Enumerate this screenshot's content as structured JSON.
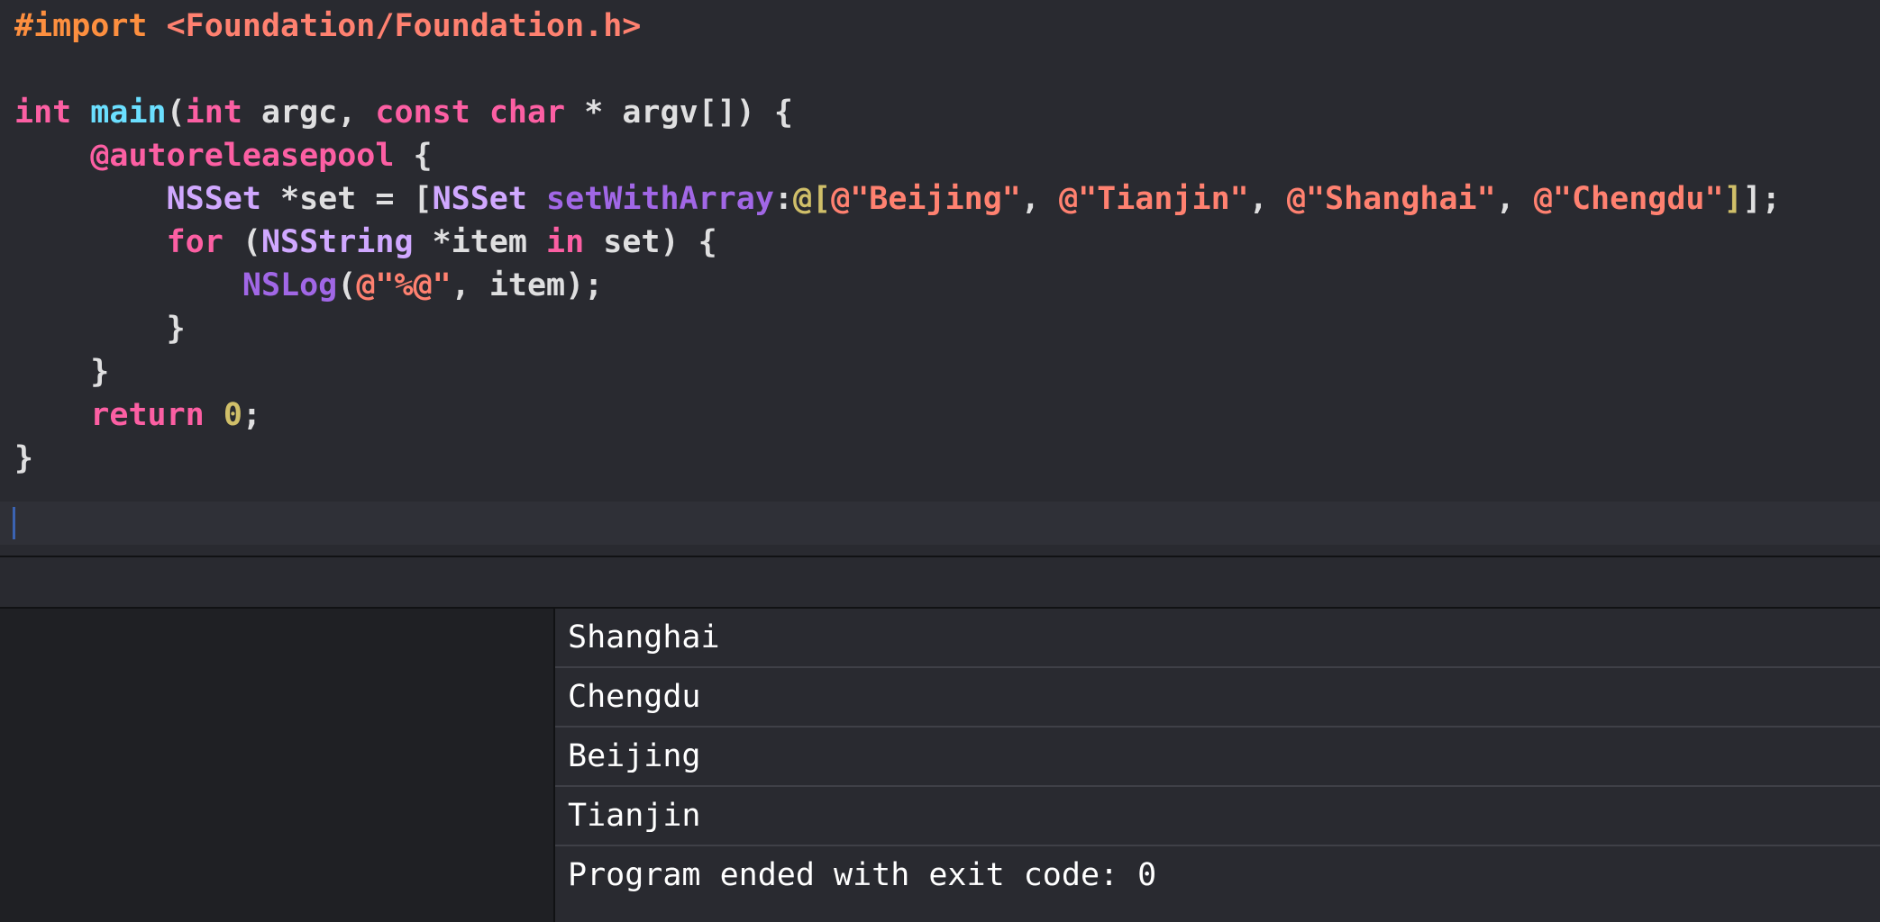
{
  "editor": {
    "lines": [
      {
        "tokens": [
          {
            "t": "#import ",
            "c": "pp"
          },
          {
            "t": "<Foundation/Foundation.h>",
            "c": "strp"
          }
        ]
      },
      {
        "tokens": []
      },
      {
        "tokens": [
          {
            "t": "int",
            "c": "kw"
          },
          {
            "t": " ",
            "c": "plain"
          },
          {
            "t": "main",
            "c": "fnd"
          },
          {
            "t": "(",
            "c": "plain"
          },
          {
            "t": "int",
            "c": "kw"
          },
          {
            "t": " argc, ",
            "c": "plain"
          },
          {
            "t": "const",
            "c": "kw"
          },
          {
            "t": " ",
            "c": "plain"
          },
          {
            "t": "char",
            "c": "kw"
          },
          {
            "t": " * argv[]) {",
            "c": "plain"
          }
        ]
      },
      {
        "tokens": [
          {
            "t": "    ",
            "c": "plain"
          },
          {
            "t": "@autoreleasepool",
            "c": "kw"
          },
          {
            "t": " {",
            "c": "plain"
          }
        ]
      },
      {
        "tokens": [
          {
            "t": "        ",
            "c": "plain"
          },
          {
            "t": "NSSet",
            "c": "cls"
          },
          {
            "t": " *set = [",
            "c": "plain"
          },
          {
            "t": "NSSet",
            "c": "cls"
          },
          {
            "t": " ",
            "c": "plain"
          },
          {
            "t": "setWithArray",
            "c": "meth"
          },
          {
            "t": ":",
            "c": "plain"
          },
          {
            "t": "@[",
            "c": "lit"
          },
          {
            "t": "@\"Beijing\"",
            "c": "strp"
          },
          {
            "t": ", ",
            "c": "plain"
          },
          {
            "t": "@\"Tianjin\"",
            "c": "strp"
          },
          {
            "t": ", ",
            "c": "plain"
          },
          {
            "t": "@\"Shanghai\"",
            "c": "strp"
          },
          {
            "t": ", ",
            "c": "plain"
          },
          {
            "t": "@\"Chengdu\"",
            "c": "strp"
          },
          {
            "t": "]",
            "c": "lit"
          },
          {
            "t": "];",
            "c": "plain"
          }
        ]
      },
      {
        "tokens": [
          {
            "t": "        ",
            "c": "plain"
          },
          {
            "t": "for",
            "c": "kw"
          },
          {
            "t": " (",
            "c": "plain"
          },
          {
            "t": "NSString",
            "c": "cls"
          },
          {
            "t": " *item ",
            "c": "plain"
          },
          {
            "t": "in",
            "c": "kw"
          },
          {
            "t": " set) {",
            "c": "plain"
          }
        ]
      },
      {
        "tokens": [
          {
            "t": "            ",
            "c": "plain"
          },
          {
            "t": "NSLog",
            "c": "meth"
          },
          {
            "t": "(",
            "c": "plain"
          },
          {
            "t": "@\"%@\"",
            "c": "strp"
          },
          {
            "t": ", item);",
            "c": "plain"
          }
        ]
      },
      {
        "tokens": [
          {
            "t": "        }",
            "c": "plain"
          }
        ]
      },
      {
        "tokens": [
          {
            "t": "    }",
            "c": "plain"
          }
        ]
      },
      {
        "tokens": [
          {
            "t": "    ",
            "c": "plain"
          },
          {
            "t": "return",
            "c": "kw"
          },
          {
            "t": " ",
            "c": "plain"
          },
          {
            "t": "0",
            "c": "num"
          },
          {
            "t": ";",
            "c": "plain"
          }
        ]
      },
      {
        "tokens": [
          {
            "t": "}",
            "c": "plain"
          }
        ]
      }
    ]
  },
  "console": {
    "lines": [
      "Shanghai",
      "Chengdu",
      "Beijing",
      "Tianjin",
      "Program ended with exit code: 0"
    ]
  },
  "colors": {
    "background": "#292a30",
    "keyword": "#fc5fa3",
    "string": "#ff8170",
    "preprocessor": "#fd8f3f",
    "class": "#d0a8ff",
    "method": "#a167e6",
    "function": "#6bdfff",
    "number": "#d0bf69"
  }
}
